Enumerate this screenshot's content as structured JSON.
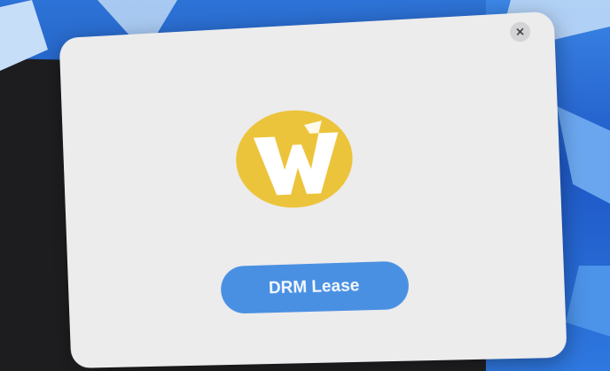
{
  "dialog": {
    "close_glyph": "×",
    "logo_icon": "wayland-logo-icon",
    "lease_button_label": "DRM Lease"
  },
  "colors": {
    "logo_yellow": "#ecc43b",
    "button_blue": "#4a90e2",
    "dialog_bg": "#ececed"
  }
}
